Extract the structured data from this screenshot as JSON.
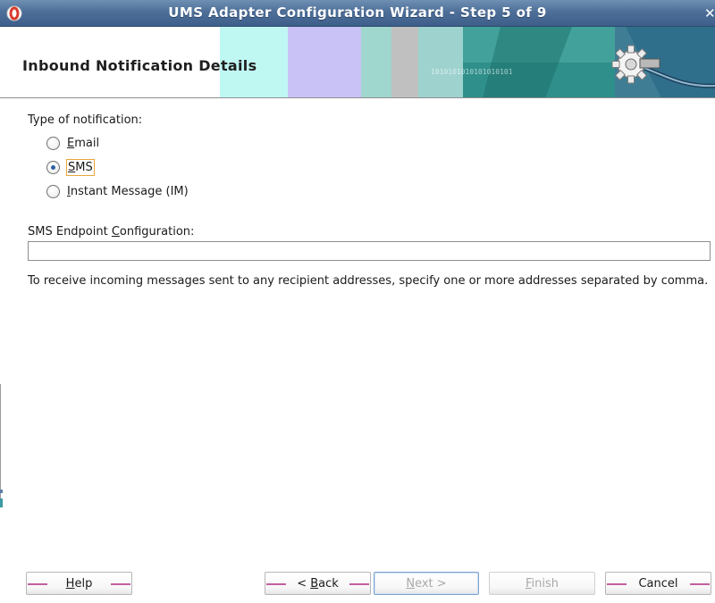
{
  "window": {
    "title": "UMS Adapter Configuration Wizard - Step 5 of 9",
    "close_glyph": "✕",
    "app_icon": "oracle-jdeveloper-icon"
  },
  "banner": {
    "title": "Inbound Notification Details",
    "binary_text": "1010101010101010101",
    "gear_icon": "gear-connector-icon"
  },
  "form": {
    "type_label": "Type of notification:",
    "options": [
      {
        "label_mn": "E",
        "label_rest": "mail",
        "checked": false
      },
      {
        "label_mn": "S",
        "label_rest": "MS",
        "checked": true
      },
      {
        "label_mn": "I",
        "label_rest": "nstant Message (IM)",
        "checked": false
      }
    ],
    "endpoint_label_pre": "SMS Endpoint ",
    "endpoint_label_mn": "C",
    "endpoint_label_post": "onfiguration:",
    "endpoint_value": "",
    "hint": "To receive incoming messages sent to any recipient addresses, specify one or more addresses separated by comma."
  },
  "buttons": {
    "help_mn": "H",
    "help_rest": "elp",
    "back_pre": "< ",
    "back_mn": "B",
    "back_rest": "ack",
    "next_mn": "N",
    "next_rest": "ext >",
    "finish_mn": "F",
    "finish_rest": "inish",
    "cancel": "Cancel"
  },
  "colors": {
    "titlebar": "#4d6f98",
    "accent_radio": "#2f5f9e",
    "focus_outline": "#e8a63a",
    "button_stripe": "#c25fa0"
  }
}
